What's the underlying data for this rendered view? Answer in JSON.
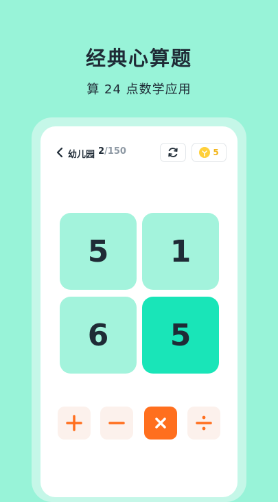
{
  "promo": {
    "headline": "经典心算题",
    "subline": "算 24 点数学应用"
  },
  "header": {
    "level_name": "幼儿园",
    "current": "2",
    "total": "/150",
    "hints": "5"
  },
  "cards": [
    {
      "value": "5",
      "selected": false
    },
    {
      "value": "1",
      "selected": false
    },
    {
      "value": "6",
      "selected": false
    },
    {
      "value": "5",
      "selected": true
    }
  ],
  "operators": [
    {
      "name": "add",
      "symbol": "plus-icon",
      "active": false
    },
    {
      "name": "subtract",
      "symbol": "minus-icon",
      "active": false
    },
    {
      "name": "multiply",
      "symbol": "times-icon",
      "active": true
    },
    {
      "name": "divide",
      "symbol": "divide-icon",
      "active": false
    }
  ],
  "colors": {
    "background": "#98f3d8",
    "card": "#a3f3dc",
    "card_selected": "#19e5b8",
    "operator": "#ff6f1e",
    "operator_bg": "#fcf1ec"
  }
}
